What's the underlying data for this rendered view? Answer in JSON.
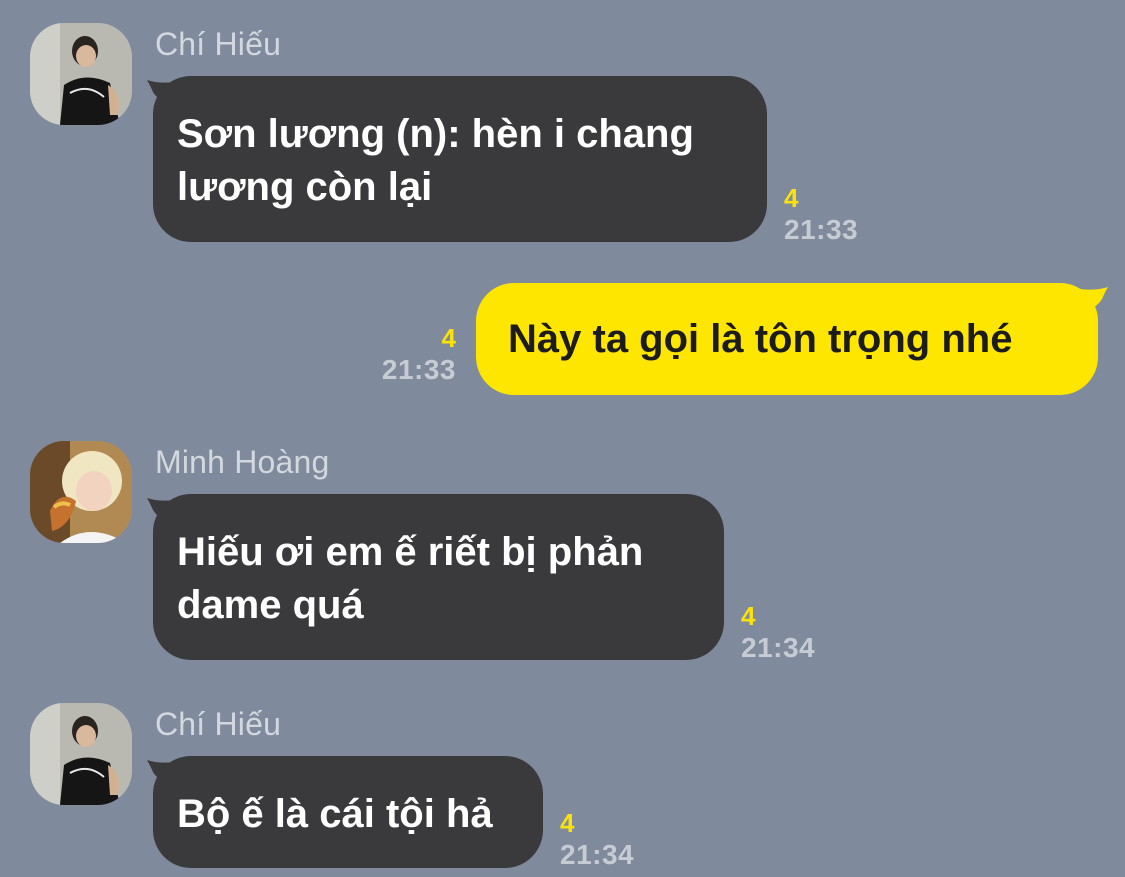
{
  "colors": {
    "background": "#7f8a9c",
    "incoming_bubble": "#3a3a3c",
    "outgoing_bubble": "#ffe600",
    "unread_count": "#fbe20d",
    "timestamp": "#c7ccd4",
    "sender_name": "#d3d8e0"
  },
  "messages": [
    {
      "sender": "Chí Hiếu",
      "lines": [
        "Sơn lương (n): hèn i chang",
        "lương còn lại"
      ],
      "unread_count": "4",
      "time": "21:33"
    },
    {
      "lines": [
        "Này ta gọi là tôn trọng nhé"
      ],
      "unread_count": "4",
      "time": "21:33"
    },
    {
      "sender": "Minh Hoàng",
      "lines": [
        "Hiếu ơi em ế riết bị phản",
        "dame quá"
      ],
      "unread_count": "4",
      "time": "21:34"
    },
    {
      "sender": "Chí Hiếu",
      "lines": [
        "Bộ ế là cái tội hả"
      ],
      "unread_count": "4",
      "time": "21:34"
    }
  ]
}
